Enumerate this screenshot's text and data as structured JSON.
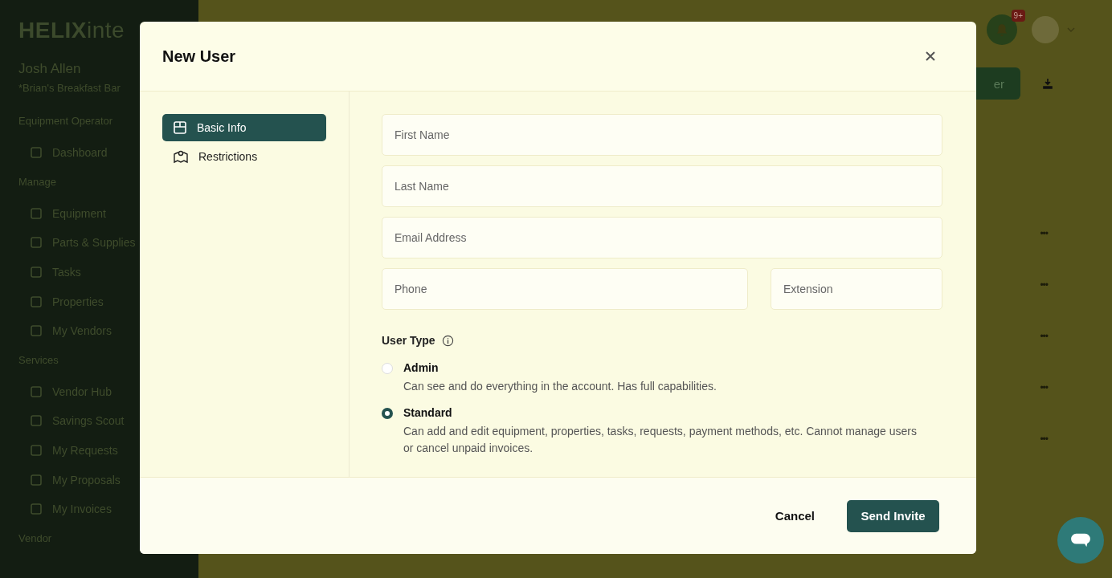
{
  "sidebar": {
    "logo_bold": "HELIX",
    "logo_light": "inte",
    "user_name": "Josh Allen",
    "company": "*Brian's Breakfast Bar",
    "role": "Equipment Operator",
    "sections": [
      {
        "items": [
          {
            "label": "Dashboard"
          }
        ]
      },
      {
        "heading": "Manage",
        "items": [
          {
            "label": "Equipment"
          },
          {
            "label": "Parts & Supplies"
          },
          {
            "label": "Tasks"
          },
          {
            "label": "Properties"
          },
          {
            "label": "My Vendors"
          }
        ]
      },
      {
        "heading": "Services",
        "items": [
          {
            "label": "Vendor Hub"
          },
          {
            "label": "Savings Scout"
          },
          {
            "label": "My Requests"
          },
          {
            "label": "My Proposals"
          },
          {
            "label": "My Invoices"
          }
        ]
      },
      {
        "heading": "Vendor"
      }
    ]
  },
  "topbar": {
    "notification_badge": "9+"
  },
  "toolbar": {
    "add_button": "er"
  },
  "row_menus": [
    "•••",
    "•••",
    "•••",
    "•••",
    "•••"
  ],
  "modal": {
    "title": "New User",
    "nav": [
      {
        "label": "Basic Info",
        "selected": true
      },
      {
        "label": "Restrictions",
        "selected": false
      }
    ],
    "field_rows": [
      [
        {
          "placeholder": "First Name"
        }
      ],
      [
        {
          "placeholder": "Last Name"
        }
      ],
      [
        {
          "placeholder": "Email Address"
        }
      ],
      [
        {
          "placeholder": "Phone"
        },
        {
          "placeholder": "Extension"
        }
      ]
    ],
    "user_type_label": "User Type",
    "options": [
      {
        "label": "Admin",
        "description": "Can see and do everything in the account. Has full capabilities.",
        "selected": false
      },
      {
        "label": "Standard",
        "description": "Can add and edit equipment, properties, tasks, requests, payment methods, etc. Cannot manage users or cancel unpaid invoices.",
        "selected": true
      }
    ],
    "cancel": "Cancel",
    "submit": "Send Invite"
  }
}
